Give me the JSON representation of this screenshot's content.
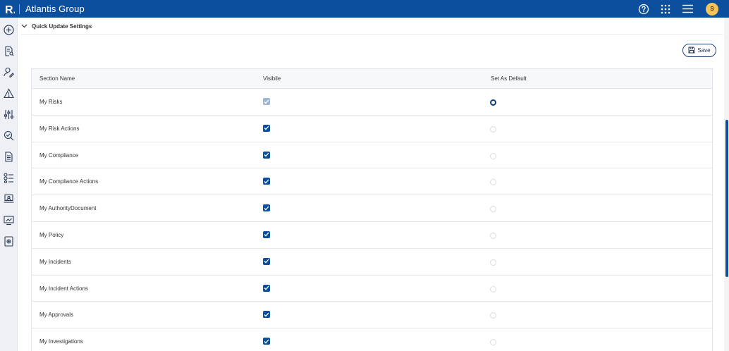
{
  "app": {
    "logo_letter": "R.",
    "title": "Atlantis Group",
    "user_initial": "S"
  },
  "colors": {
    "topbar": "#0b4f9e",
    "accent": "#0b4f9e",
    "avatar": "#f6c35a"
  },
  "top_icons": [
    "help-icon",
    "apps-grid-icon",
    "menu-icon"
  ],
  "sidebar_icons": [
    "add-circle-icon",
    "document-search-icon",
    "user-edit-icon",
    "warning-icon",
    "sliders-icon",
    "search-check-icon",
    "report-icon",
    "checklist-icon",
    "monitor-user-icon",
    "chart-screen-icon",
    "document-gear-icon"
  ],
  "section": {
    "title": "Quick Update Settings",
    "expanded": true
  },
  "toolbar": {
    "save_label": "Save"
  },
  "table": {
    "headers": {
      "name": "Section Name",
      "visible": "Visibile",
      "default": "Set As Default"
    },
    "rows": [
      {
        "name": "My Risks",
        "visible": true,
        "visible_disabled": true,
        "default": true
      },
      {
        "name": "My Risk Actions",
        "visible": true,
        "visible_disabled": false,
        "default": false
      },
      {
        "name": "My Compliance",
        "visible": true,
        "visible_disabled": false,
        "default": false
      },
      {
        "name": "My Compliance Actions",
        "visible": true,
        "visible_disabled": false,
        "default": false
      },
      {
        "name": "My AuthorityDocument",
        "visible": true,
        "visible_disabled": false,
        "default": false
      },
      {
        "name": "My Policy",
        "visible": true,
        "visible_disabled": false,
        "default": false
      },
      {
        "name": "My Incidents",
        "visible": true,
        "visible_disabled": false,
        "default": false
      },
      {
        "name": "My Incident Actions",
        "visible": true,
        "visible_disabled": false,
        "default": false
      },
      {
        "name": "My Approvals",
        "visible": true,
        "visible_disabled": false,
        "default": false
      },
      {
        "name": "My Investigations",
        "visible": true,
        "visible_disabled": false,
        "default": false
      }
    ]
  }
}
